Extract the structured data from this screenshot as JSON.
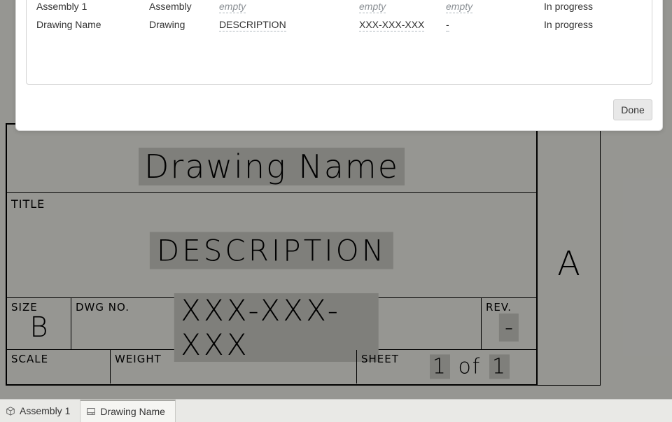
{
  "modal": {
    "rows": [
      {
        "name": "Assembly 1",
        "type": "Assembly",
        "description_empty": "empty",
        "number_empty": "empty",
        "rev_empty": "empty",
        "state": "In progress"
      },
      {
        "name": "Drawing Name",
        "type": "Drawing",
        "description": "DESCRIPTION",
        "number": "XXX-XXX-XXX",
        "rev": "-",
        "state": "In progress"
      }
    ],
    "done_label": "Done"
  },
  "title_block": {
    "drawing_name": "Drawing Name",
    "title_label": "TITLE",
    "description": "DESCRIPTION",
    "size_label": "SIZE",
    "size_value": "B",
    "dwgno_label": "DWG NO.",
    "dwgno_value": "XXX-XXX-XXX",
    "rev_label": "REV.",
    "rev_value": "-",
    "scale_label": "SCALE",
    "weight_label": "WEIGHT",
    "sheet_label": "SHEET",
    "sheet_value_current": "1",
    "sheet_value_of": "of",
    "sheet_value_total": "1",
    "side_letter": "A"
  },
  "tabs": {
    "assembly_label": "Assembly 1",
    "drawing_label": "Drawing Name"
  }
}
